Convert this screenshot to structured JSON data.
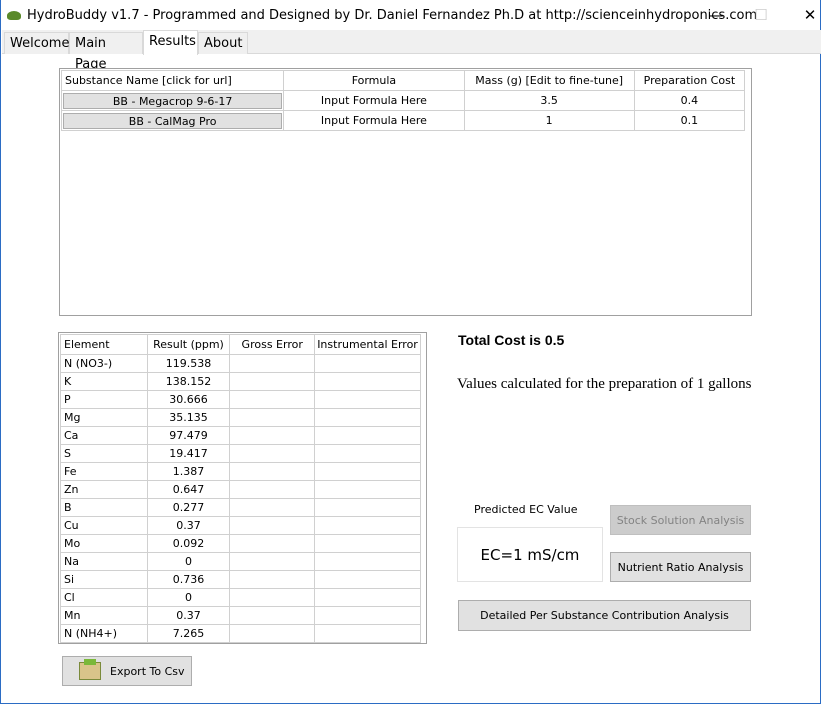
{
  "window": {
    "title": "HydroBuddy v1.7 - Programmed and Designed by Dr. Daniel Fernandez Ph.D at http://scienceinhydroponics.com",
    "minimize": "—",
    "maximize": "☐",
    "close": "✕"
  },
  "tabs": [
    {
      "label": "Welcome"
    },
    {
      "label": "Main Page"
    },
    {
      "label": "Results",
      "active": true
    },
    {
      "label": "About"
    }
  ],
  "substances": {
    "headers": [
      "Substance Name [click for url]",
      "Formula",
      "Mass (g) [Edit to fine-tune]",
      "Preparation Cost"
    ],
    "rows": [
      {
        "name": "BB - Megacrop 9-6-17",
        "formula": "Input Formula Here",
        "mass": "3.5",
        "cost": "0.4"
      },
      {
        "name": "BB - CalMag Pro",
        "formula": "Input Formula Here",
        "mass": "1",
        "cost": "0.1"
      }
    ]
  },
  "elements": {
    "headers": [
      "Element",
      "Result (ppm)",
      "Gross Error",
      "Instrumental Error"
    ],
    "rows": [
      {
        "el": "N (NO3-)",
        "ppm": "119.538"
      },
      {
        "el": "K",
        "ppm": "138.152"
      },
      {
        "el": "P",
        "ppm": "30.666"
      },
      {
        "el": "Mg",
        "ppm": "35.135"
      },
      {
        "el": "Ca",
        "ppm": "97.479"
      },
      {
        "el": "S",
        "ppm": "19.417"
      },
      {
        "el": "Fe",
        "ppm": "1.387"
      },
      {
        "el": "Zn",
        "ppm": "0.647"
      },
      {
        "el": "B",
        "ppm": "0.277"
      },
      {
        "el": "Cu",
        "ppm": "0.37"
      },
      {
        "el": "Mo",
        "ppm": "0.092"
      },
      {
        "el": "Na",
        "ppm": "0"
      },
      {
        "el": "Si",
        "ppm": "0.736"
      },
      {
        "el": "Cl",
        "ppm": "0"
      },
      {
        "el": "Mn",
        "ppm": "0.37"
      },
      {
        "el": "N (NH4+)",
        "ppm": "7.265"
      }
    ]
  },
  "summary": {
    "total_cost": "Total Cost is 0.5",
    "values_note": "Values calculated for the preparation of 1 gallons"
  },
  "ec": {
    "label": "Predicted EC Value",
    "value": "EC=1 mS/cm"
  },
  "buttons": {
    "stock": "Stock Solution Analysis",
    "ratio": "Nutrient Ratio Analysis",
    "detailed": "Detailed Per Substance Contribution Analysis",
    "export": "Export To Csv"
  }
}
